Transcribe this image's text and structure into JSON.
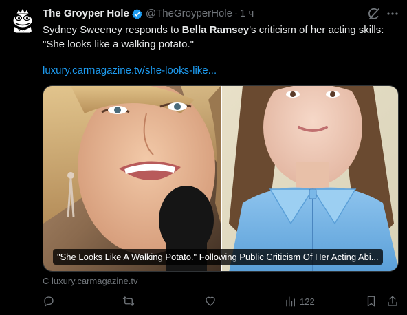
{
  "tweet": {
    "author_name": "The Groyper Hole",
    "handle": "@TheGroyperHole",
    "separator": "·",
    "time": "1 ч",
    "text_before": "Sydney Sweeney responds to ",
    "text_mention": "Bella Ramsey",
    "text_after": "'s criticism of her acting skills: \"She looks like a walking potato.\"",
    "link_text": "luxury.carmagazine.tv/she-looks-like..."
  },
  "card": {
    "title": "\"She Looks Like A Walking Potato.\" Following Public Criticism Of Her Acting Abi...",
    "source": "С luxury.carmagazine.tv"
  },
  "actions": {
    "views_count": "122"
  },
  "colors": {
    "background": "#000000",
    "text": "#e7e9ea",
    "secondary": "#71767b",
    "link": "#1d9bf0",
    "verified": "#1d9bf0"
  },
  "icons": [
    "avatar-frog",
    "verified-badge-icon",
    "grok-icon",
    "more-icon",
    "reply-icon",
    "repost-icon",
    "like-icon",
    "views-icon",
    "bookmark-icon",
    "share-icon"
  ]
}
